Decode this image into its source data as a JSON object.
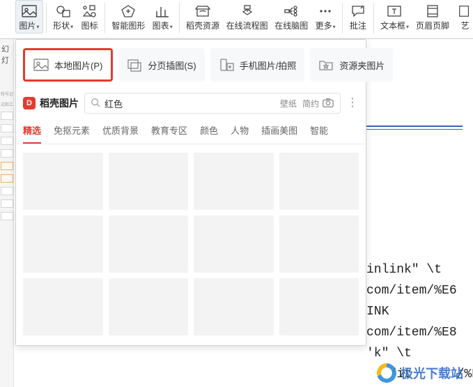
{
  "ribbon": {
    "items": [
      {
        "id": "image",
        "label": "图片",
        "caret": true,
        "active": true
      },
      {
        "id": "shape",
        "label": "形状",
        "caret": true
      },
      {
        "id": "iconlib",
        "label": "图标",
        "caret": false
      },
      {
        "id": "smart",
        "label": "智能图形",
        "caret": false
      },
      {
        "id": "chart",
        "label": "图表",
        "caret": true
      },
      {
        "id": "docer-res",
        "label": "稻壳资源",
        "caret": false
      },
      {
        "id": "online-flow",
        "label": "在线流程图",
        "caret": false
      },
      {
        "id": "online-mind",
        "label": "在线脑图",
        "caret": false
      },
      {
        "id": "more",
        "label": "更多",
        "caret": true
      },
      {
        "id": "comment",
        "label": "批注",
        "caret": false
      },
      {
        "id": "textbox",
        "label": "文本框",
        "caret": true
      },
      {
        "id": "headerfooter",
        "label": "页眉页脚",
        "caret": false
      },
      {
        "id": "art",
        "label": "艺",
        "caret": false
      }
    ]
  },
  "left": {
    "slide_label": "幻灯",
    "note1": "符号记",
    "note2": "式和工"
  },
  "doc_background": "inlink\" \\t\ncom/item/%E6\nINK\ncom/item/%E8\n'k\" \\t\n   /it      /%E6",
  "sources": [
    {
      "id": "local",
      "label": "本地图片(P)"
    },
    {
      "id": "page",
      "label": "分页插图(S)"
    },
    {
      "id": "phone",
      "label": "手机图片/拍照"
    },
    {
      "id": "folder",
      "label": "资源夹图片"
    }
  ],
  "brand": {
    "name": "稻壳图片",
    "logo": "D"
  },
  "search": {
    "placeholder": "",
    "value": "红色",
    "chips": [
      "壁纸",
      "简约"
    ]
  },
  "categories": [
    "精选",
    "免抠元素",
    "优质背景",
    "教育专区",
    "颜色",
    "人物",
    "插画美图",
    "智能"
  ],
  "active_category": 0,
  "grid": {
    "count": 12
  },
  "watermark": "极光下载站"
}
